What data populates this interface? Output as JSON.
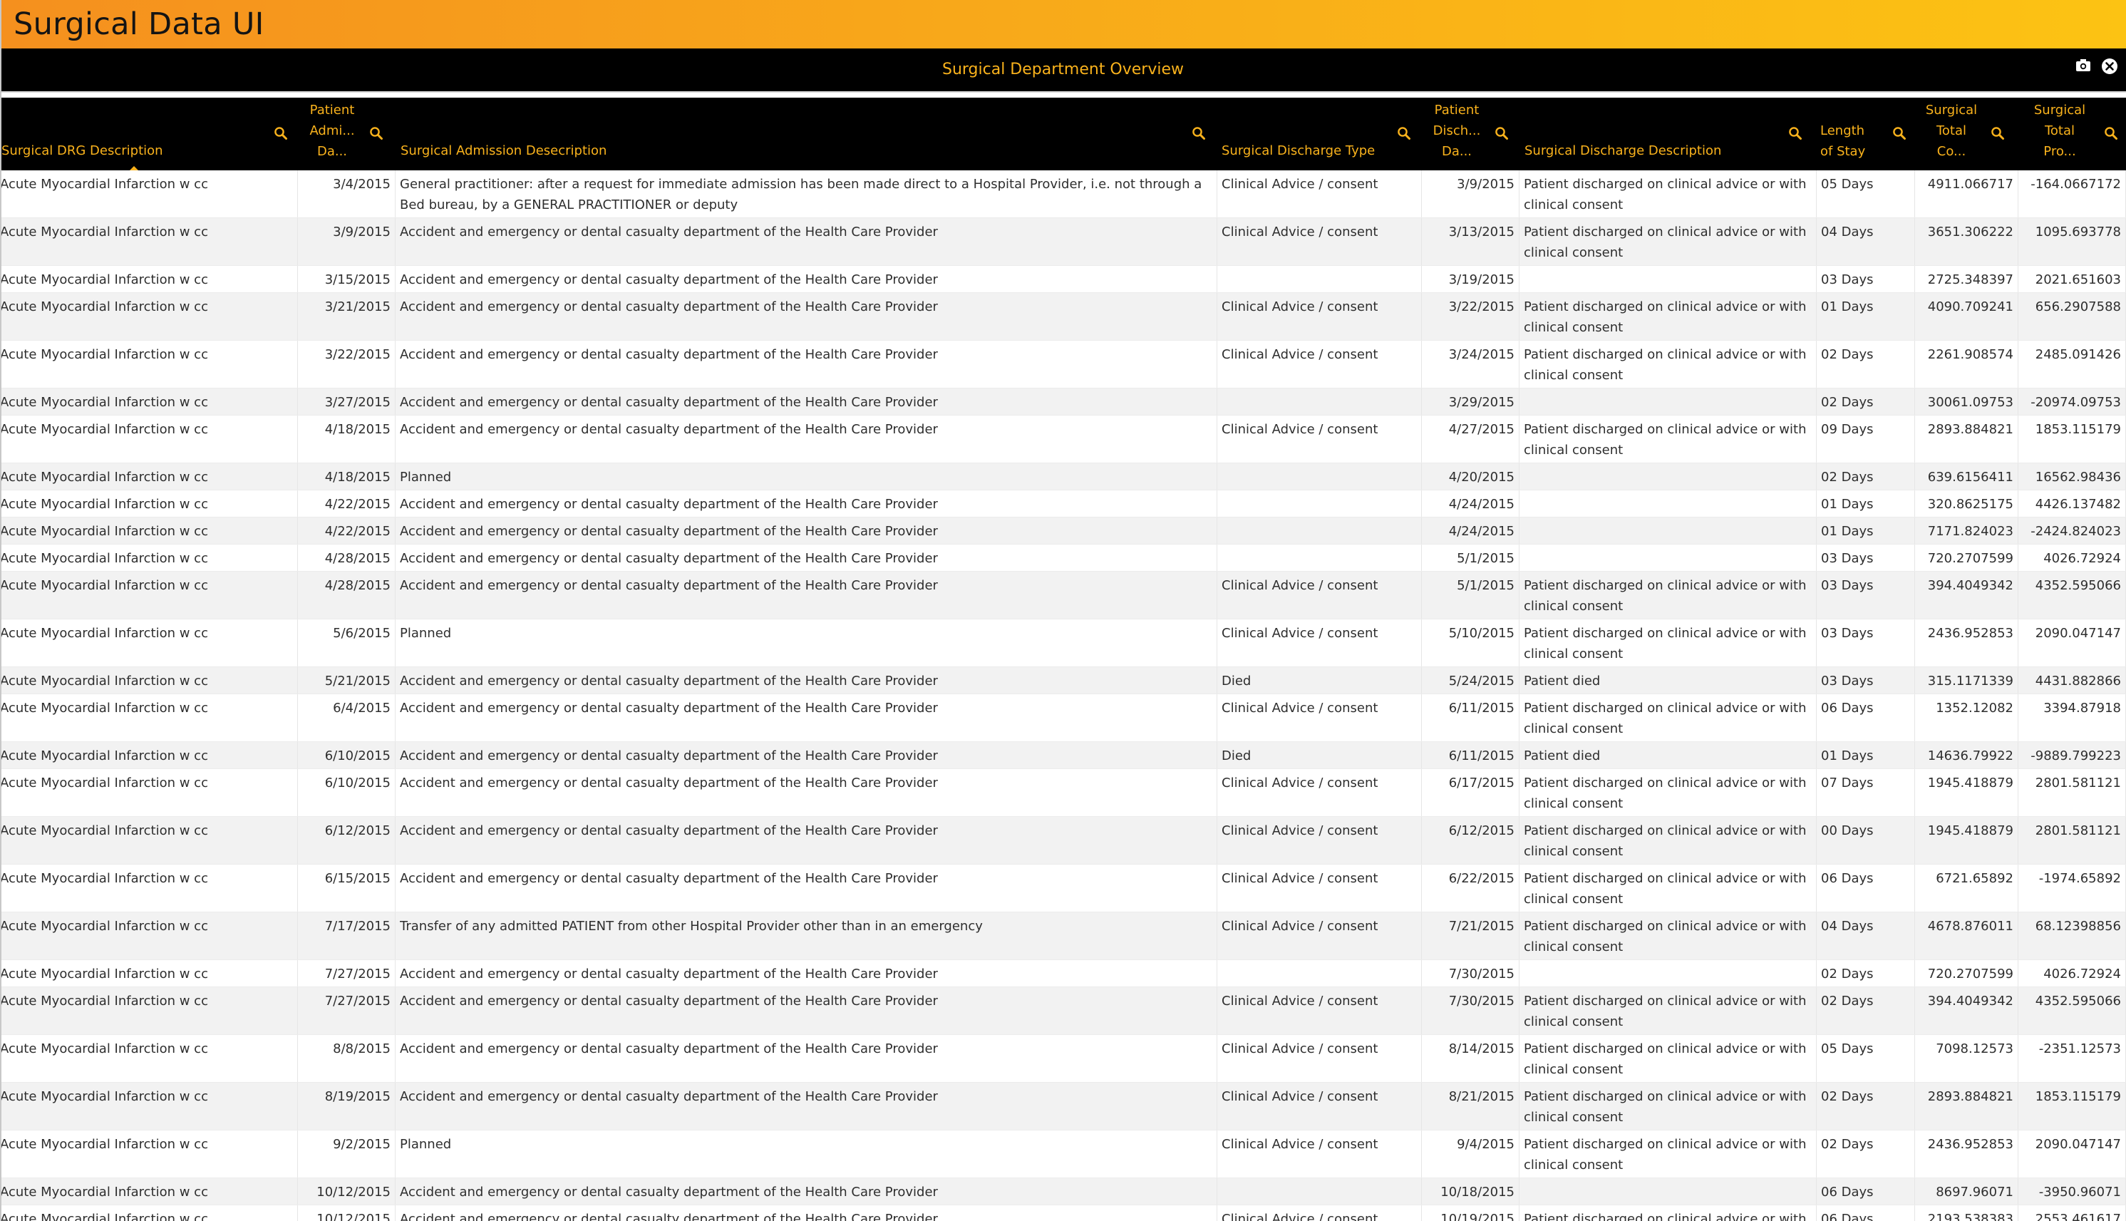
{
  "app": {
    "title": "Surgical Data UI"
  },
  "panel": {
    "title": "Surgical Department Overview",
    "icons": [
      "camera-icon",
      "close-icon"
    ]
  },
  "colors": {
    "accent": "#f9b21c",
    "header_bg": "#000000",
    "topbar_start": "#f5901e",
    "topbar_end": "#fcc313"
  },
  "table": {
    "headers": [
      {
        "lines": [
          "Surgical DRG Description"
        ],
        "sorted": "ascending"
      },
      {
        "lines": [
          "Patient",
          "Admi...",
          "Da..."
        ]
      },
      {
        "lines": [
          "Surgical Admission Desecription"
        ]
      },
      {
        "lines": [
          "Surgical Discharge Type"
        ]
      },
      {
        "lines": [
          "Patient",
          "Disch...",
          "Da..."
        ]
      },
      {
        "lines": [
          "Surgical Discharge Description"
        ]
      },
      {
        "lines": [
          "Length",
          "of Stay"
        ]
      },
      {
        "lines": [
          "Surgical",
          "Total",
          "Co..."
        ]
      },
      {
        "lines": [
          "Surgical",
          "Total",
          "Pro..."
        ]
      }
    ],
    "rows": [
      [
        "Acute Myocardial Infarction w cc",
        "3/4/2015",
        "General practitioner: after a request for immediate admission has been made direct to a Hospital Provider, i.e. not through a Bed bureau, by a GENERAL PRACTITIONER or deputy",
        "Clinical Advice / consent",
        "3/9/2015",
        "Patient discharged on clinical advice or with clinical consent",
        "05 Days",
        "4911.066717",
        "-164.0667172"
      ],
      [
        "Acute Myocardial Infarction w cc",
        "3/9/2015",
        "Accident and emergency or dental casualty department of the Health Care Provider",
        "Clinical Advice / consent",
        "3/13/2015",
        "Patient discharged on clinical advice or with clinical consent",
        "04 Days",
        "3651.306222",
        "1095.693778"
      ],
      [
        "Acute Myocardial Infarction w cc",
        "3/15/2015",
        "Accident and emergency or dental casualty department of the Health Care Provider",
        "",
        "3/19/2015",
        "",
        "03 Days",
        "2725.348397",
        "2021.651603"
      ],
      [
        "Acute Myocardial Infarction w cc",
        "3/21/2015",
        "Accident and emergency or dental casualty department of the Health Care Provider",
        "Clinical Advice / consent",
        "3/22/2015",
        "Patient discharged on clinical advice or with clinical consent",
        "01 Days",
        "4090.709241",
        "656.2907588"
      ],
      [
        "Acute Myocardial Infarction w cc",
        "3/22/2015",
        "Accident and emergency or dental casualty department of the Health Care Provider",
        "Clinical Advice / consent",
        "3/24/2015",
        "Patient discharged on clinical advice or with clinical consent",
        "02 Days",
        "2261.908574",
        "2485.091426"
      ],
      [
        "Acute Myocardial Infarction w cc",
        "3/27/2015",
        "Accident and emergency or dental casualty department of the Health Care Provider",
        "",
        "3/29/2015",
        "",
        "02 Days",
        "30061.09753",
        "-20974.09753"
      ],
      [
        "Acute Myocardial Infarction w cc",
        "4/18/2015",
        "Accident and emergency or dental casualty department of the Health Care Provider",
        "Clinical Advice / consent",
        "4/27/2015",
        "Patient discharged on clinical advice or with clinical consent",
        "09 Days",
        "2893.884821",
        "1853.115179"
      ],
      [
        "Acute Myocardial Infarction w cc",
        "4/18/2015",
        "Planned",
        "",
        "4/20/2015",
        "",
        "02 Days",
        "639.6156411",
        "16562.98436"
      ],
      [
        "Acute Myocardial Infarction w cc",
        "4/22/2015",
        "Accident and emergency or dental casualty department of the Health Care Provider",
        "",
        "4/24/2015",
        "",
        "01 Days",
        "320.8625175",
        "4426.137482"
      ],
      [
        "Acute Myocardial Infarction w cc",
        "4/22/2015",
        "Accident and emergency or dental casualty department of the Health Care Provider",
        "",
        "4/24/2015",
        "",
        "01 Days",
        "7171.824023",
        "-2424.824023"
      ],
      [
        "Acute Myocardial Infarction w cc",
        "4/28/2015",
        "Accident and emergency or dental casualty department of the Health Care Provider",
        "",
        "5/1/2015",
        "",
        "03 Days",
        "720.2707599",
        "4026.72924"
      ],
      [
        "Acute Myocardial Infarction w cc",
        "4/28/2015",
        "Accident and emergency or dental casualty department of the Health Care Provider",
        "Clinical Advice / consent",
        "5/1/2015",
        "Patient discharged on clinical advice or with clinical consent",
        "03 Days",
        "394.4049342",
        "4352.595066"
      ],
      [
        "Acute Myocardial Infarction w cc",
        "5/6/2015",
        "Planned",
        "Clinical Advice / consent",
        "5/10/2015",
        "Patient discharged on clinical advice or with clinical consent",
        "03 Days",
        "2436.952853",
        "2090.047147"
      ],
      [
        "Acute Myocardial Infarction w cc",
        "5/21/2015",
        "Accident and emergency or dental casualty department of the Health Care Provider",
        "Died",
        "5/24/2015",
        "Patient died",
        "03 Days",
        "315.1171339",
        "4431.882866"
      ],
      [
        "Acute Myocardial Infarction w cc",
        "6/4/2015",
        "Accident and emergency or dental casualty department of the Health Care Provider",
        "Clinical Advice / consent",
        "6/11/2015",
        "Patient discharged on clinical advice or with clinical consent",
        "06 Days",
        "1352.12082",
        "3394.87918"
      ],
      [
        "Acute Myocardial Infarction w cc",
        "6/10/2015",
        "Accident and emergency or dental casualty department of the Health Care Provider",
        "Died",
        "6/11/2015",
        "Patient died",
        "01 Days",
        "14636.79922",
        "-9889.799223"
      ],
      [
        "Acute Myocardial Infarction w cc",
        "6/10/2015",
        "Accident and emergency or dental casualty department of the Health Care Provider",
        "Clinical Advice / consent",
        "6/17/2015",
        "Patient discharged on clinical advice or with clinical consent",
        "07 Days",
        "1945.418879",
        "2801.581121"
      ],
      [
        "Acute Myocardial Infarction w cc",
        "6/12/2015",
        "Accident and emergency or dental casualty department of the Health Care Provider",
        "Clinical Advice / consent",
        "6/12/2015",
        "Patient discharged on clinical advice or with clinical consent",
        "00 Days",
        "1945.418879",
        "2801.581121"
      ],
      [
        "Acute Myocardial Infarction w cc",
        "6/15/2015",
        "Accident and emergency or dental casualty department of the Health Care Provider",
        "Clinical Advice / consent",
        "6/22/2015",
        "Patient discharged on clinical advice or with clinical consent",
        "06 Days",
        "6721.65892",
        "-1974.65892"
      ],
      [
        "Acute Myocardial Infarction w cc",
        "7/17/2015",
        "Transfer of any admitted PATIENT from other Hospital Provider other than in an emergency",
        "Clinical Advice / consent",
        "7/21/2015",
        "Patient discharged on clinical advice or with clinical consent",
        "04 Days",
        "4678.876011",
        "68.12398856"
      ],
      [
        "Acute Myocardial Infarction w cc",
        "7/27/2015",
        "Accident and emergency or dental casualty department of the Health Care Provider",
        "",
        "7/30/2015",
        "",
        "02 Days",
        "720.2707599",
        "4026.72924"
      ],
      [
        "Acute Myocardial Infarction w cc",
        "7/27/2015",
        "Accident and emergency or dental casualty department of the Health Care Provider",
        "Clinical Advice / consent",
        "7/30/2015",
        "Patient discharged on clinical advice or with clinical consent",
        "02 Days",
        "394.4049342",
        "4352.595066"
      ],
      [
        "Acute Myocardial Infarction w cc",
        "8/8/2015",
        "Accident and emergency or dental casualty department of the Health Care Provider",
        "Clinical Advice / consent",
        "8/14/2015",
        "Patient discharged on clinical advice or with clinical consent",
        "05 Days",
        "7098.12573",
        "-2351.12573"
      ],
      [
        "Acute Myocardial Infarction w cc",
        "8/19/2015",
        "Accident and emergency or dental casualty department of the Health Care Provider",
        "Clinical Advice / consent",
        "8/21/2015",
        "Patient discharged on clinical advice or with clinical consent",
        "02 Days",
        "2893.884821",
        "1853.115179"
      ],
      [
        "Acute Myocardial Infarction w cc",
        "9/2/2015",
        "Planned",
        "Clinical Advice / consent",
        "9/4/2015",
        "Patient discharged on clinical advice or with clinical consent",
        "02 Days",
        "2436.952853",
        "2090.047147"
      ],
      [
        "Acute Myocardial Infarction w cc",
        "10/12/2015",
        "Accident and emergency or dental casualty department of the Health Care Provider",
        "",
        "10/18/2015",
        "",
        "06 Days",
        "8697.96071",
        "-3950.96071"
      ],
      [
        "Acute Myocardial Infarction w cc",
        "10/12/2015",
        "Accident and emergency or dental casualty department of the Health Care Provider",
        "Clinical Advice / consent",
        "10/19/2015",
        "Patient discharged on clinical advice or with clinical consent",
        "06 Days",
        "2193.538383",
        "2553.461617"
      ]
    ]
  }
}
